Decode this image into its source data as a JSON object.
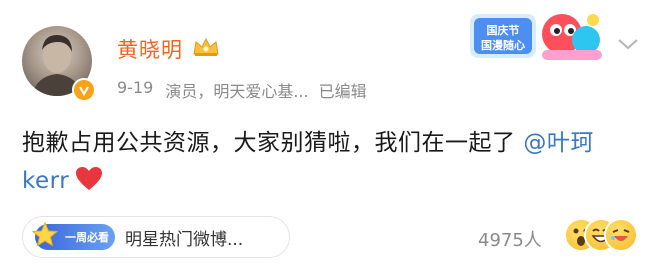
{
  "post": {
    "author": "黄晓明",
    "date": "9-19",
    "source": "演员，明天爱心基...",
    "edited": "已编辑",
    "text_main": "抱歉占用公共资源，大家别猜啦，我们在一起了 ",
    "mention": "@叶珂 kerr",
    "badge_text": "国庆节 国漫随心",
    "pill_badge_text": "一周必看",
    "pill_label": "明星热门微博...",
    "like_count": "4975人",
    "accent_name_color": "#f0651f",
    "mention_color": "#3b78c2"
  }
}
